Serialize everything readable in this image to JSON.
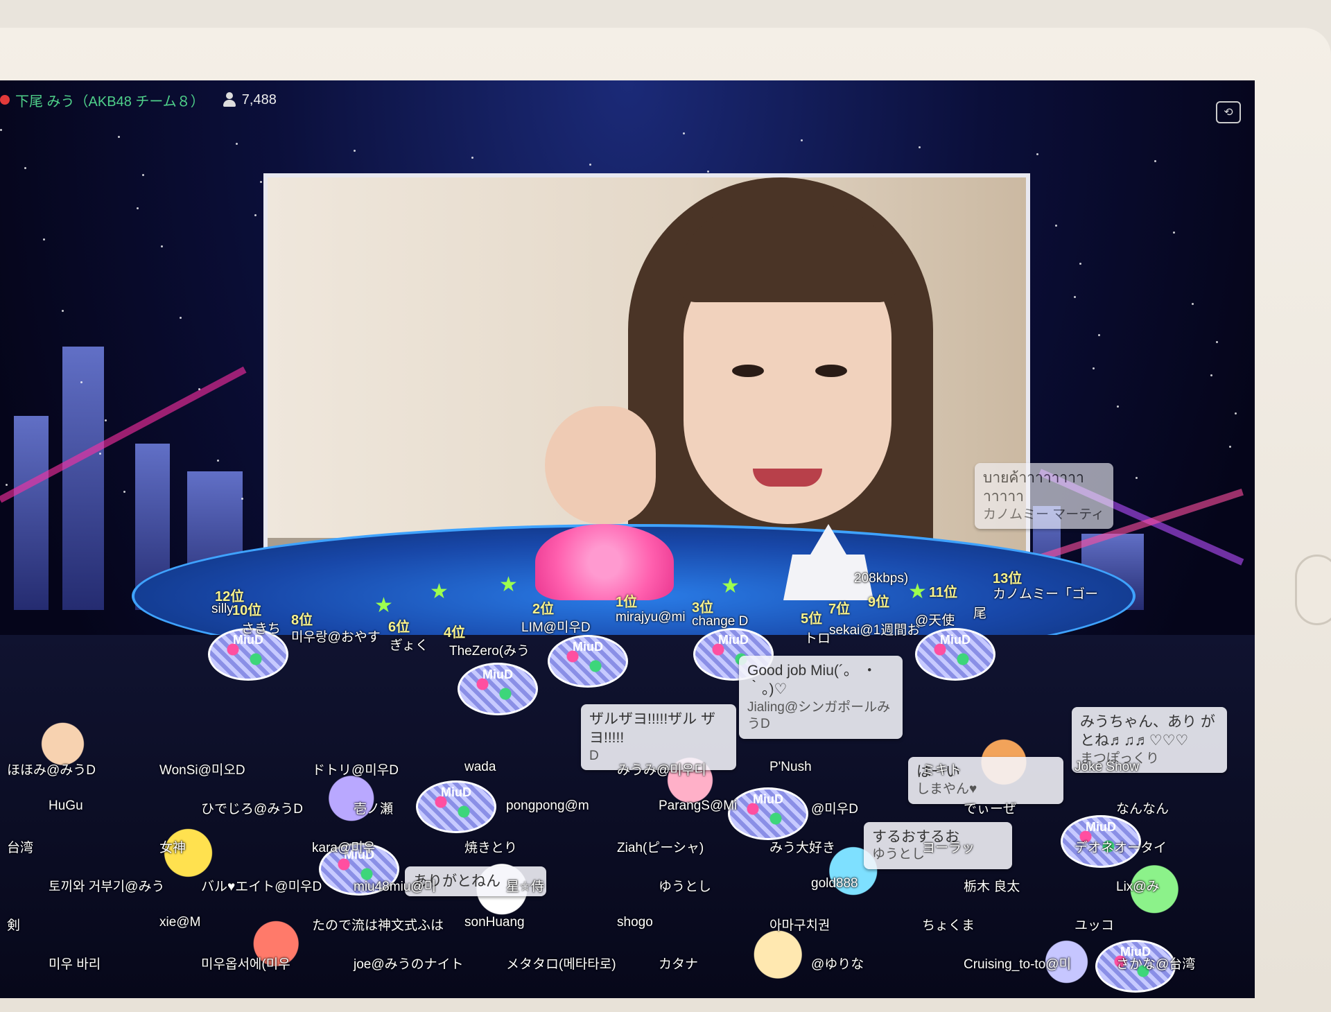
{
  "topbar": {
    "streamer": "下尾 みう（AKB48 チーム８）",
    "viewers": "7,488"
  },
  "comments": [
    {
      "text": "บายค้าาาาาาาา าาาาา",
      "user": "カノムミー マーティ"
    },
    {
      "text": "Good job Miu(´。 ・｀。)♡",
      "user": "Jialing@シンガポールみうD"
    },
    {
      "text": "ザルザヨ!!!!!ザル ザヨ!!!!!",
      "user": "D"
    },
    {
      "text": "みうちゃん、あり がとね♬♫♬♡♡♡",
      "user": "まつぽっくり"
    },
    {
      "text": "はーい",
      "user": "しまやん♥"
    },
    {
      "text": "するおするお",
      "user": "ゆうとし"
    },
    {
      "text": "ありがとねん",
      "user": ""
    }
  ],
  "ranks": [
    {
      "rank": "12位",
      "user": "silly"
    },
    {
      "rank": "10位",
      "user": "さきち"
    },
    {
      "rank": "8位",
      "user": "미우랑@おやす"
    },
    {
      "rank": "6位",
      "user": "ぎょく"
    },
    {
      "rank": "4位",
      "user": "TheZero(みう"
    },
    {
      "rank": "2位",
      "user": "LIM@미우D"
    },
    {
      "rank": "1位",
      "user": "mirajyu@mi"
    },
    {
      "rank": "3位",
      "user": "change D"
    },
    {
      "rank": "5位",
      "user": "トロ"
    },
    {
      "rank": "7位",
      "user": "sekai@1週間お"
    },
    {
      "rank": "9位",
      "user": "@天使"
    },
    {
      "rank": "11位",
      "user": "尾"
    },
    {
      "rank": "13位",
      "user": "カノムミー「ゴー"
    }
  ],
  "bitrate": "208kbps)",
  "crowd_names": [
    "ほほみ@みうD",
    "WonSi@미오D",
    "ドトリ@미우D",
    "wada",
    "みうみ@미우디",
    "P'Nush",
    "ミキト",
    "Joke Snow",
    "HuGu",
    "ひでじろ@みうD",
    "壱ノ瀬",
    "pongpong@m",
    "ParangS@Mi",
    "@미우D",
    "でぃーぜ",
    "なんなん",
    "台湾",
    "女神",
    "kara@미우",
    "焼きとり",
    "Ziah(ピーシャ)",
    "みう大好き",
    "ヨーラッ",
    "デオネオータイ",
    "토끼와 거부기@みう",
    "バル♥エイト@미우D",
    "miu48miu@미",
    "星☆侍",
    "ゆうとし",
    "gold888",
    "栃木 良太",
    "Lix@み",
    "剣",
    "xie@M",
    "たので流は神文式ふは",
    "sonHuang",
    "shogo",
    "아마구치권",
    "ちょくま",
    "ユッコ",
    "미우 바리",
    "미우옵서에(미우",
    "joe@みうのナイト",
    "メタタロ(메타타로)",
    "カタナ",
    "@ゆりな",
    "Cruising_to-to@미",
    "さかな@台湾"
  ],
  "colors": {
    "name_green": "#4fd18a",
    "rank_yellow": "#f8f28c"
  },
  "icons": [
    "live-dot-icon",
    "viewer-icon",
    "camera-switch-icon"
  ]
}
